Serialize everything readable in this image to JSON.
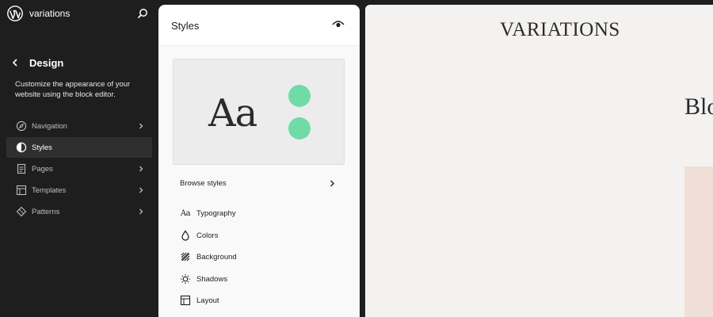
{
  "site": {
    "title": "variations"
  },
  "sidebar": {
    "section_title": "Design",
    "description": "Customize the appearance of your website using the block editor.",
    "items": [
      {
        "label": "Navigation",
        "icon": "compass-icon",
        "active": false,
        "has_chevron": true
      },
      {
        "label": "Styles",
        "icon": "half-circle-icon",
        "active": true,
        "has_chevron": false
      },
      {
        "label": "Pages",
        "icon": "page-icon",
        "active": false,
        "has_chevron": true
      },
      {
        "label": "Templates",
        "icon": "layout-icon",
        "active": false,
        "has_chevron": true
      },
      {
        "label": "Patterns",
        "icon": "diamond-icon",
        "active": false,
        "has_chevron": true
      }
    ]
  },
  "styles_panel": {
    "title": "Styles",
    "preview": {
      "sample_text": "Aa",
      "accent_color": "#71dba8"
    },
    "browse_label": "Browse styles",
    "items": [
      {
        "label": "Typography",
        "icon": "aa-icon"
      },
      {
        "label": "Colors",
        "icon": "droplet-icon"
      },
      {
        "label": "Background",
        "icon": "background-icon"
      },
      {
        "label": "Shadows",
        "icon": "shadow-icon"
      },
      {
        "label": "Layout",
        "icon": "layout-icon"
      }
    ]
  },
  "canvas": {
    "site_title": "VARIATIONS",
    "heading_fragment": "Blo"
  },
  "colors": {
    "sidebar_bg": "#1e1e1e",
    "active_item_bg": "#2f2f2f",
    "panel_bg": "#ffffff",
    "canvas_bg": "#f3f2f0",
    "image_block": "#efdfd6"
  }
}
